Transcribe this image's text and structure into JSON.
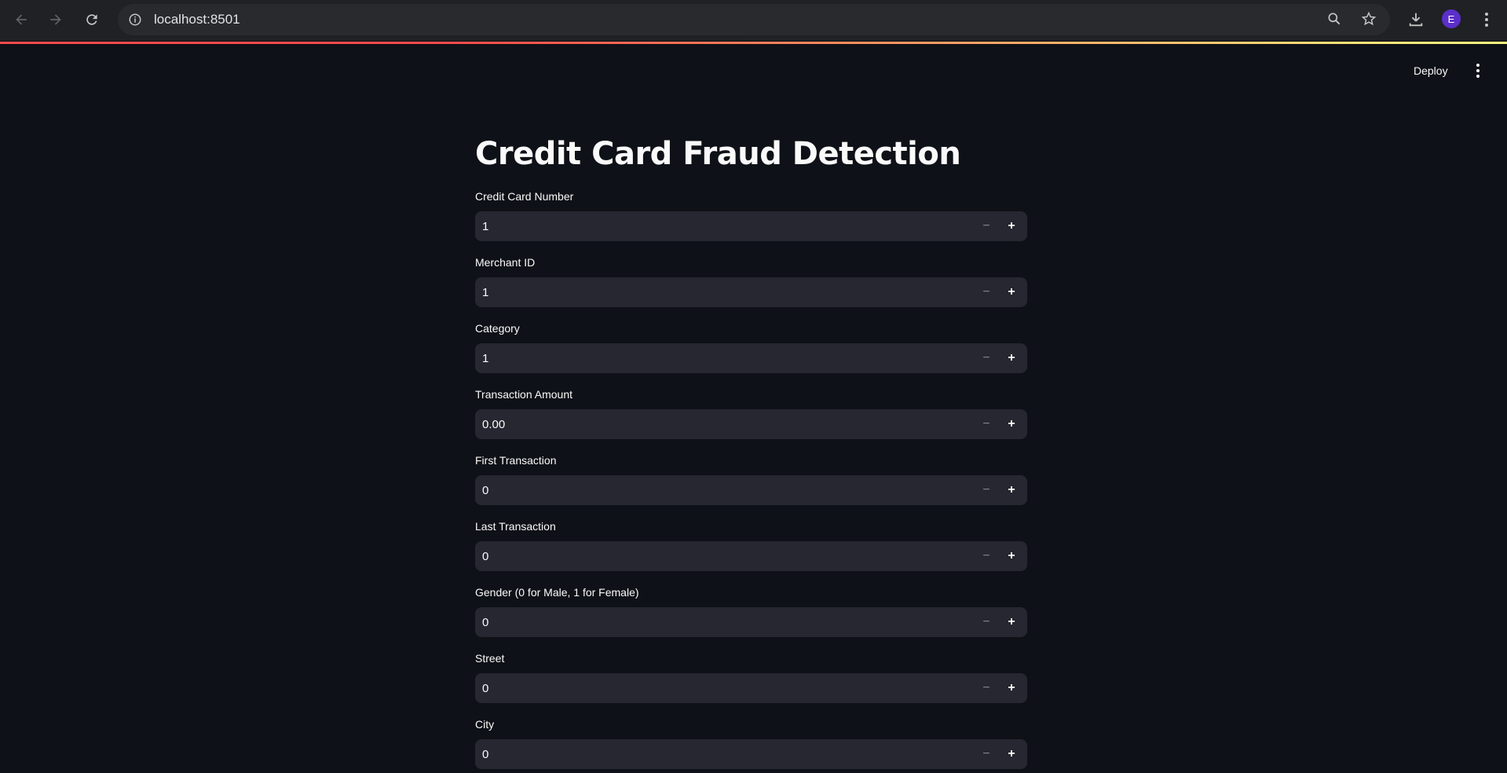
{
  "browser": {
    "url": "localhost:8501",
    "avatar_letter": "E",
    "icons": [
      "back-arrow-icon",
      "forward-arrow-icon",
      "reload-icon",
      "site-info-icon",
      "zoom-icon",
      "bookmark-star-icon",
      "download-icon",
      "menu-kebab-icon"
    ]
  },
  "app_header": {
    "deploy_label": "Deploy"
  },
  "main": {
    "title": "Credit Card Fraud Detection",
    "fields": [
      {
        "label": "Credit Card Number",
        "value": "1"
      },
      {
        "label": "Merchant ID",
        "value": "1"
      },
      {
        "label": "Category",
        "value": "1"
      },
      {
        "label": "Transaction Amount",
        "value": "0.00"
      },
      {
        "label": "First Transaction",
        "value": "0"
      },
      {
        "label": "Last Transaction",
        "value": "0"
      },
      {
        "label": "Gender (0 for Male, 1 for Female)",
        "value": "0"
      },
      {
        "label": "Street",
        "value": "0"
      },
      {
        "label": "City",
        "value": "0"
      }
    ],
    "stepper": {
      "minus": "−",
      "plus": "+"
    }
  },
  "colors": {
    "background": "#0e1117",
    "input_background": "#262730",
    "text": "#fafafa",
    "accent_red": "#ff4b4b",
    "avatar": "#5b2fc9"
  }
}
